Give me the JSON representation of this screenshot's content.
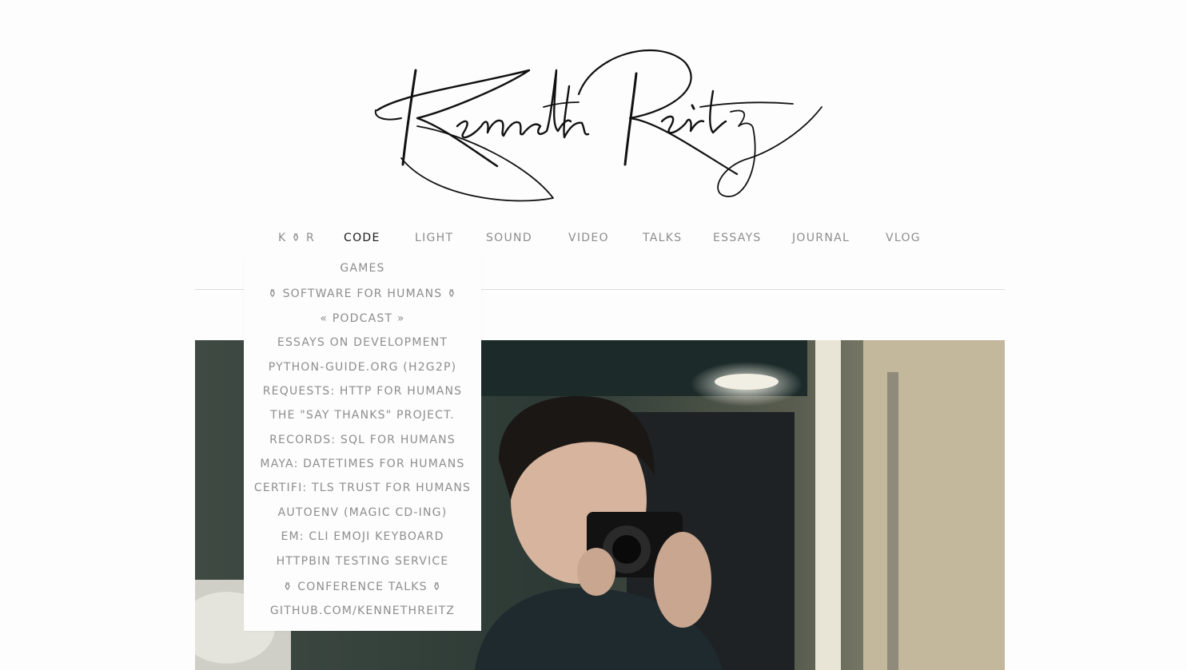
{
  "logo": {
    "text": "Kenneth Reitz",
    "icon": "signature-logo"
  },
  "nav": {
    "items": [
      {
        "label": "K ⚱ R",
        "active": false
      },
      {
        "label": "CODE",
        "active": true
      },
      {
        "label": "LIGHT",
        "active": false
      },
      {
        "label": "SOUND",
        "active": false
      },
      {
        "label": "VIDEO",
        "active": false
      },
      {
        "label": "TALKS",
        "active": false
      },
      {
        "label": "ESSAYS",
        "active": false
      },
      {
        "label": "JOURNAL",
        "active": false
      },
      {
        "label": "VLOG",
        "active": false
      }
    ]
  },
  "dropdown": {
    "items": [
      "GAMES",
      "⚱ SOFTWARE FOR HUMANS ⚱",
      "« PODCAST »",
      "ESSAYS ON DEVELOPMENT",
      "PYTHON-GUIDE.ORG (H2G2P)",
      "REQUESTS: HTTP FOR HUMANS",
      "THE \"SAY THANKS\" PROJECT.",
      "RECORDS: SQL FOR HUMANS",
      "MAYA: DATETIMES FOR HUMANS",
      "CERTIFI: TLS TRUST FOR HUMANS",
      "AUTOENV (MAGIC CD-ING)",
      "EM: CLI EMOJI KEYBOARD",
      "HTTPBIN TESTING SERVICE",
      "⚱ CONFERENCE TALKS ⚱",
      "GITHUB.COM/KENNETHREITZ"
    ]
  },
  "colors": {
    "background": "#fdfdfd",
    "nav_text": "#8d8d8d",
    "nav_active": "#1a1a1a",
    "divider": "#dcdcdc"
  }
}
